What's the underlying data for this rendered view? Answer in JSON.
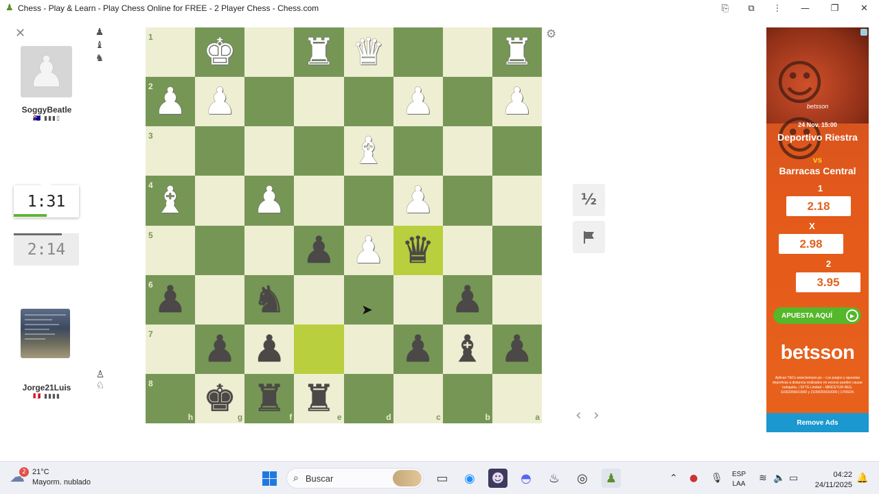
{
  "window": {
    "title": "Chess - Play & Learn - Play Chess Online for FREE - 2 Player Chess - Chess.com"
  },
  "top_player": {
    "name": "SoggyBeatle",
    "flag": "🇦🇺 ▮▮▮▯",
    "clock": "2:14",
    "captured": [
      "♟",
      "♝",
      "♞"
    ]
  },
  "bottom_player": {
    "name": "Jorge21Luis",
    "flag": "🇵🇪 ▮▮▮▮",
    "clock": "1:31",
    "captured": [
      "♙",
      "♘"
    ],
    "clock_fraction": 0.5
  },
  "board": {
    "orientation": "black",
    "ranks": [
      "1",
      "2",
      "3",
      "4",
      "5",
      "6",
      "7",
      "8"
    ],
    "files": [
      "h",
      "g",
      "f",
      "e",
      "d",
      "c",
      "b",
      "a"
    ],
    "highlighted": [
      "c5",
      "e7"
    ],
    "pieces": [
      {
        "sq": "g1",
        "p": "K",
        "c": "w"
      },
      {
        "sq": "e1",
        "p": "R",
        "c": "w"
      },
      {
        "sq": "d1",
        "p": "Q",
        "c": "w"
      },
      {
        "sq": "a1",
        "p": "R",
        "c": "w"
      },
      {
        "sq": "h2",
        "p": "P",
        "c": "w"
      },
      {
        "sq": "g2",
        "p": "P",
        "c": "w"
      },
      {
        "sq": "c2",
        "p": "P",
        "c": "w"
      },
      {
        "sq": "a2",
        "p": "P",
        "c": "w"
      },
      {
        "sq": "d3",
        "p": "B",
        "c": "w"
      },
      {
        "sq": "h4",
        "p": "B",
        "c": "w"
      },
      {
        "sq": "f4",
        "p": "P",
        "c": "w"
      },
      {
        "sq": "c4",
        "p": "P",
        "c": "w"
      },
      {
        "sq": "e5",
        "p": "P",
        "c": "b"
      },
      {
        "sq": "d5",
        "p": "P",
        "c": "w"
      },
      {
        "sq": "c5",
        "p": "Q",
        "c": "b"
      },
      {
        "sq": "h6",
        "p": "P",
        "c": "b"
      },
      {
        "sq": "f6",
        "p": "N",
        "c": "b"
      },
      {
        "sq": "b6",
        "p": "P",
        "c": "b"
      },
      {
        "sq": "g7",
        "p": "P",
        "c": "b"
      },
      {
        "sq": "f7",
        "p": "P",
        "c": "b"
      },
      {
        "sq": "c7",
        "p": "P",
        "c": "b"
      },
      {
        "sq": "b7",
        "p": "B",
        "c": "b"
      },
      {
        "sq": "a7",
        "p": "P",
        "c": "b"
      },
      {
        "sq": "g8",
        "p": "K",
        "c": "b"
      },
      {
        "sq": "f8",
        "p": "R",
        "c": "b"
      },
      {
        "sq": "e8",
        "p": "R",
        "c": "b"
      }
    ]
  },
  "controls": {
    "draw_label": "½",
    "resign_icon": "flag-icon",
    "prev_icon": "‹",
    "next_icon": "›"
  },
  "ad": {
    "brand_small": "betsson",
    "date": "24 Nov. 15:00",
    "team1": "Deportivo Riestra",
    "vs": "vs",
    "team2": "Barracas Central",
    "odds": [
      {
        "label": "1",
        "value": "2.18"
      },
      {
        "label": "X",
        "value": "2.98"
      },
      {
        "label": "2",
        "value": "3.95"
      }
    ],
    "cta": "APUESTA AQUÍ",
    "logo": "betsson",
    "legal": "Aplican T&Cs www.betsson.pe – Los juegos y apuestas deportivas a distancia realizados en exceso pueden causar ludopatía. | SFTG Limited – MINCETUR REG. 11002356010000 y 21000256010000 | 17/06/24.",
    "remove_label": "Remove Ads"
  },
  "taskbar": {
    "temp": "21°C",
    "weather": "Mayorm. nublado",
    "weather_badge": "2",
    "search_placeholder": "Buscar",
    "lang1": "ESP",
    "lang2": "LAA",
    "time": "04:22",
    "date": "24/11/2025"
  },
  "colors": {
    "light_square": "#eeeed2",
    "dark_square": "#769656",
    "highlight": "#baca2b",
    "ad_orange": "#e45a1a",
    "remove_ads_blue": "#1a98cf"
  }
}
